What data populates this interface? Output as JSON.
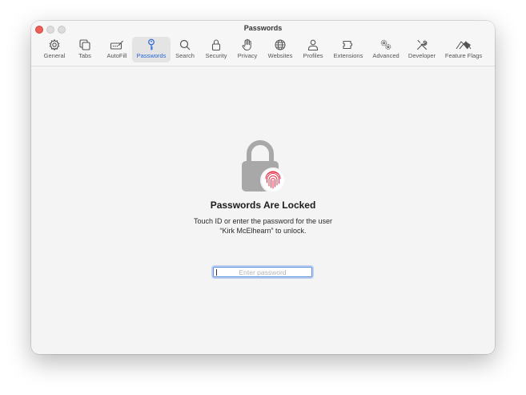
{
  "window": {
    "title": "Passwords"
  },
  "toolbar": {
    "active_tab": "Passwords",
    "tabs": [
      {
        "label": "General",
        "icon": "gear-icon"
      },
      {
        "label": "Tabs",
        "icon": "tabs-icon"
      },
      {
        "label": "AutoFill",
        "icon": "autofill-icon"
      },
      {
        "label": "Passwords",
        "icon": "key-icon"
      },
      {
        "label": "Search",
        "icon": "search-icon"
      },
      {
        "label": "Security",
        "icon": "lock-icon"
      },
      {
        "label": "Privacy",
        "icon": "hand-icon"
      },
      {
        "label": "Websites",
        "icon": "globe-icon"
      },
      {
        "label": "Profiles",
        "icon": "person-icon"
      },
      {
        "label": "Extensions",
        "icon": "puzzle-icon"
      },
      {
        "label": "Advanced",
        "icon": "gears-icon"
      },
      {
        "label": "Developer",
        "icon": "tools-icon"
      },
      {
        "label": "Feature Flags",
        "icon": "flags-icon"
      }
    ]
  },
  "locked": {
    "title": "Passwords Are Locked",
    "description_line1": "Touch ID or enter the password for the user",
    "description_line2": "“Kirk McElhearn” to unlock.",
    "password_value": "",
    "password_placeholder": "Enter password"
  },
  "colors": {
    "accent": "#2a66d9",
    "close_button": "#ec5f57",
    "lock_gray": "#a8a8a8",
    "fingerprint_red": "#e8384f"
  }
}
